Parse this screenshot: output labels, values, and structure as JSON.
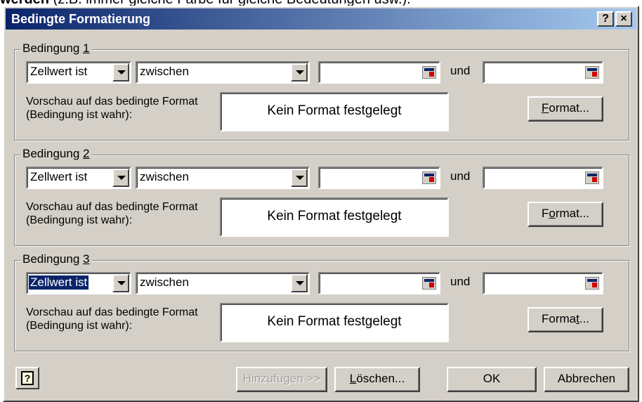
{
  "background_text": {
    "bold": "werden",
    "rest": " (z.B. immer gleiche Farbe für gleiche Bedeutungen usw.)."
  },
  "window": {
    "title": "Bedingte Formatierung",
    "help_glyph": "?",
    "close_glyph": "×"
  },
  "conditions": [
    {
      "legend_prefix": "Bedingung ",
      "legend_key": "1",
      "type_value": "Zellwert ist",
      "operator_value": "zwischen",
      "value1": "",
      "and_label": "und",
      "value2": "",
      "preview_label": "Vorschau auf das bedingte Format (Bedingung ist wahr):",
      "preview_text": "Kein Format festgelegt",
      "format_button": {
        "pre": "",
        "key": "F",
        "post": "ormat..."
      }
    },
    {
      "legend_prefix": "Bedingung ",
      "legend_key": "2",
      "type_value": "Zellwert ist",
      "operator_value": "zwischen",
      "value1": "",
      "and_label": "und",
      "value2": "",
      "preview_label": "Vorschau auf das bedingte Format (Bedingung ist wahr):",
      "preview_text": "Kein Format festgelegt",
      "format_button": {
        "pre": "F",
        "key": "o",
        "post": "rmat..."
      }
    },
    {
      "legend_prefix": "Bedingung ",
      "legend_key": "3",
      "type_value": "Zellwert ist",
      "operator_value": "zwischen",
      "value1": "",
      "and_label": "und",
      "value2": "",
      "preview_label": "Vorschau auf das bedingte Format (Bedingung ist wahr):",
      "preview_text": "Kein Format festgelegt",
      "format_button": {
        "pre": "Forma",
        "key": "t",
        "post": "..."
      }
    }
  ],
  "footer": {
    "add_label": "Hinzufügen >>",
    "delete": {
      "key": "L",
      "post": "öschen..."
    },
    "ok_label": "OK",
    "cancel_label": "Abbrechen",
    "help_glyph": "?"
  }
}
